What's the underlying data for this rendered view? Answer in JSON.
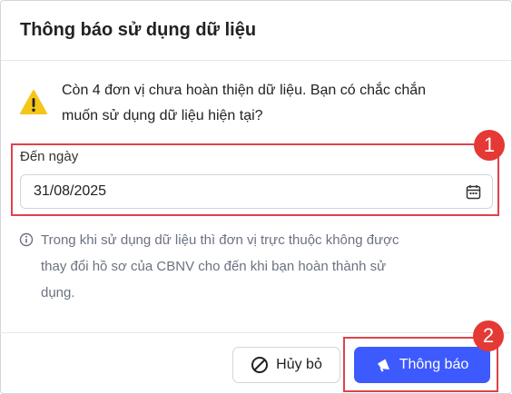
{
  "dialog": {
    "title": "Thông báo sử dụng dữ liệu",
    "warning_icon": "warning-icon",
    "warning_text_line1": "Còn 4 đơn vị chưa hoàn thiện dữ liệu. Bạn có chắc chắn",
    "warning_text_line2": "muốn sử dụng dữ liệu hiện tại?",
    "date_label": "Đến ngày",
    "date_value": "31/08/2025",
    "calendar_icon": "calendar-icon",
    "info_icon": "info-icon",
    "info_text_line1": "Trong khi sử dụng dữ liệu thì đơn vị trực thuộc không được",
    "info_text_line2": "thay đổi hồ sơ của CBNV cho đến khi bạn hoàn thành sử",
    "info_text_line3": "dụng.",
    "cancel_label": "Hủy bỏ",
    "notify_label": "Thông báo"
  },
  "badges": {
    "first": "1",
    "second": "2"
  },
  "colors": {
    "primary": "#3d5afe",
    "highlight": "#e0424b",
    "warning": "#f5c518"
  }
}
